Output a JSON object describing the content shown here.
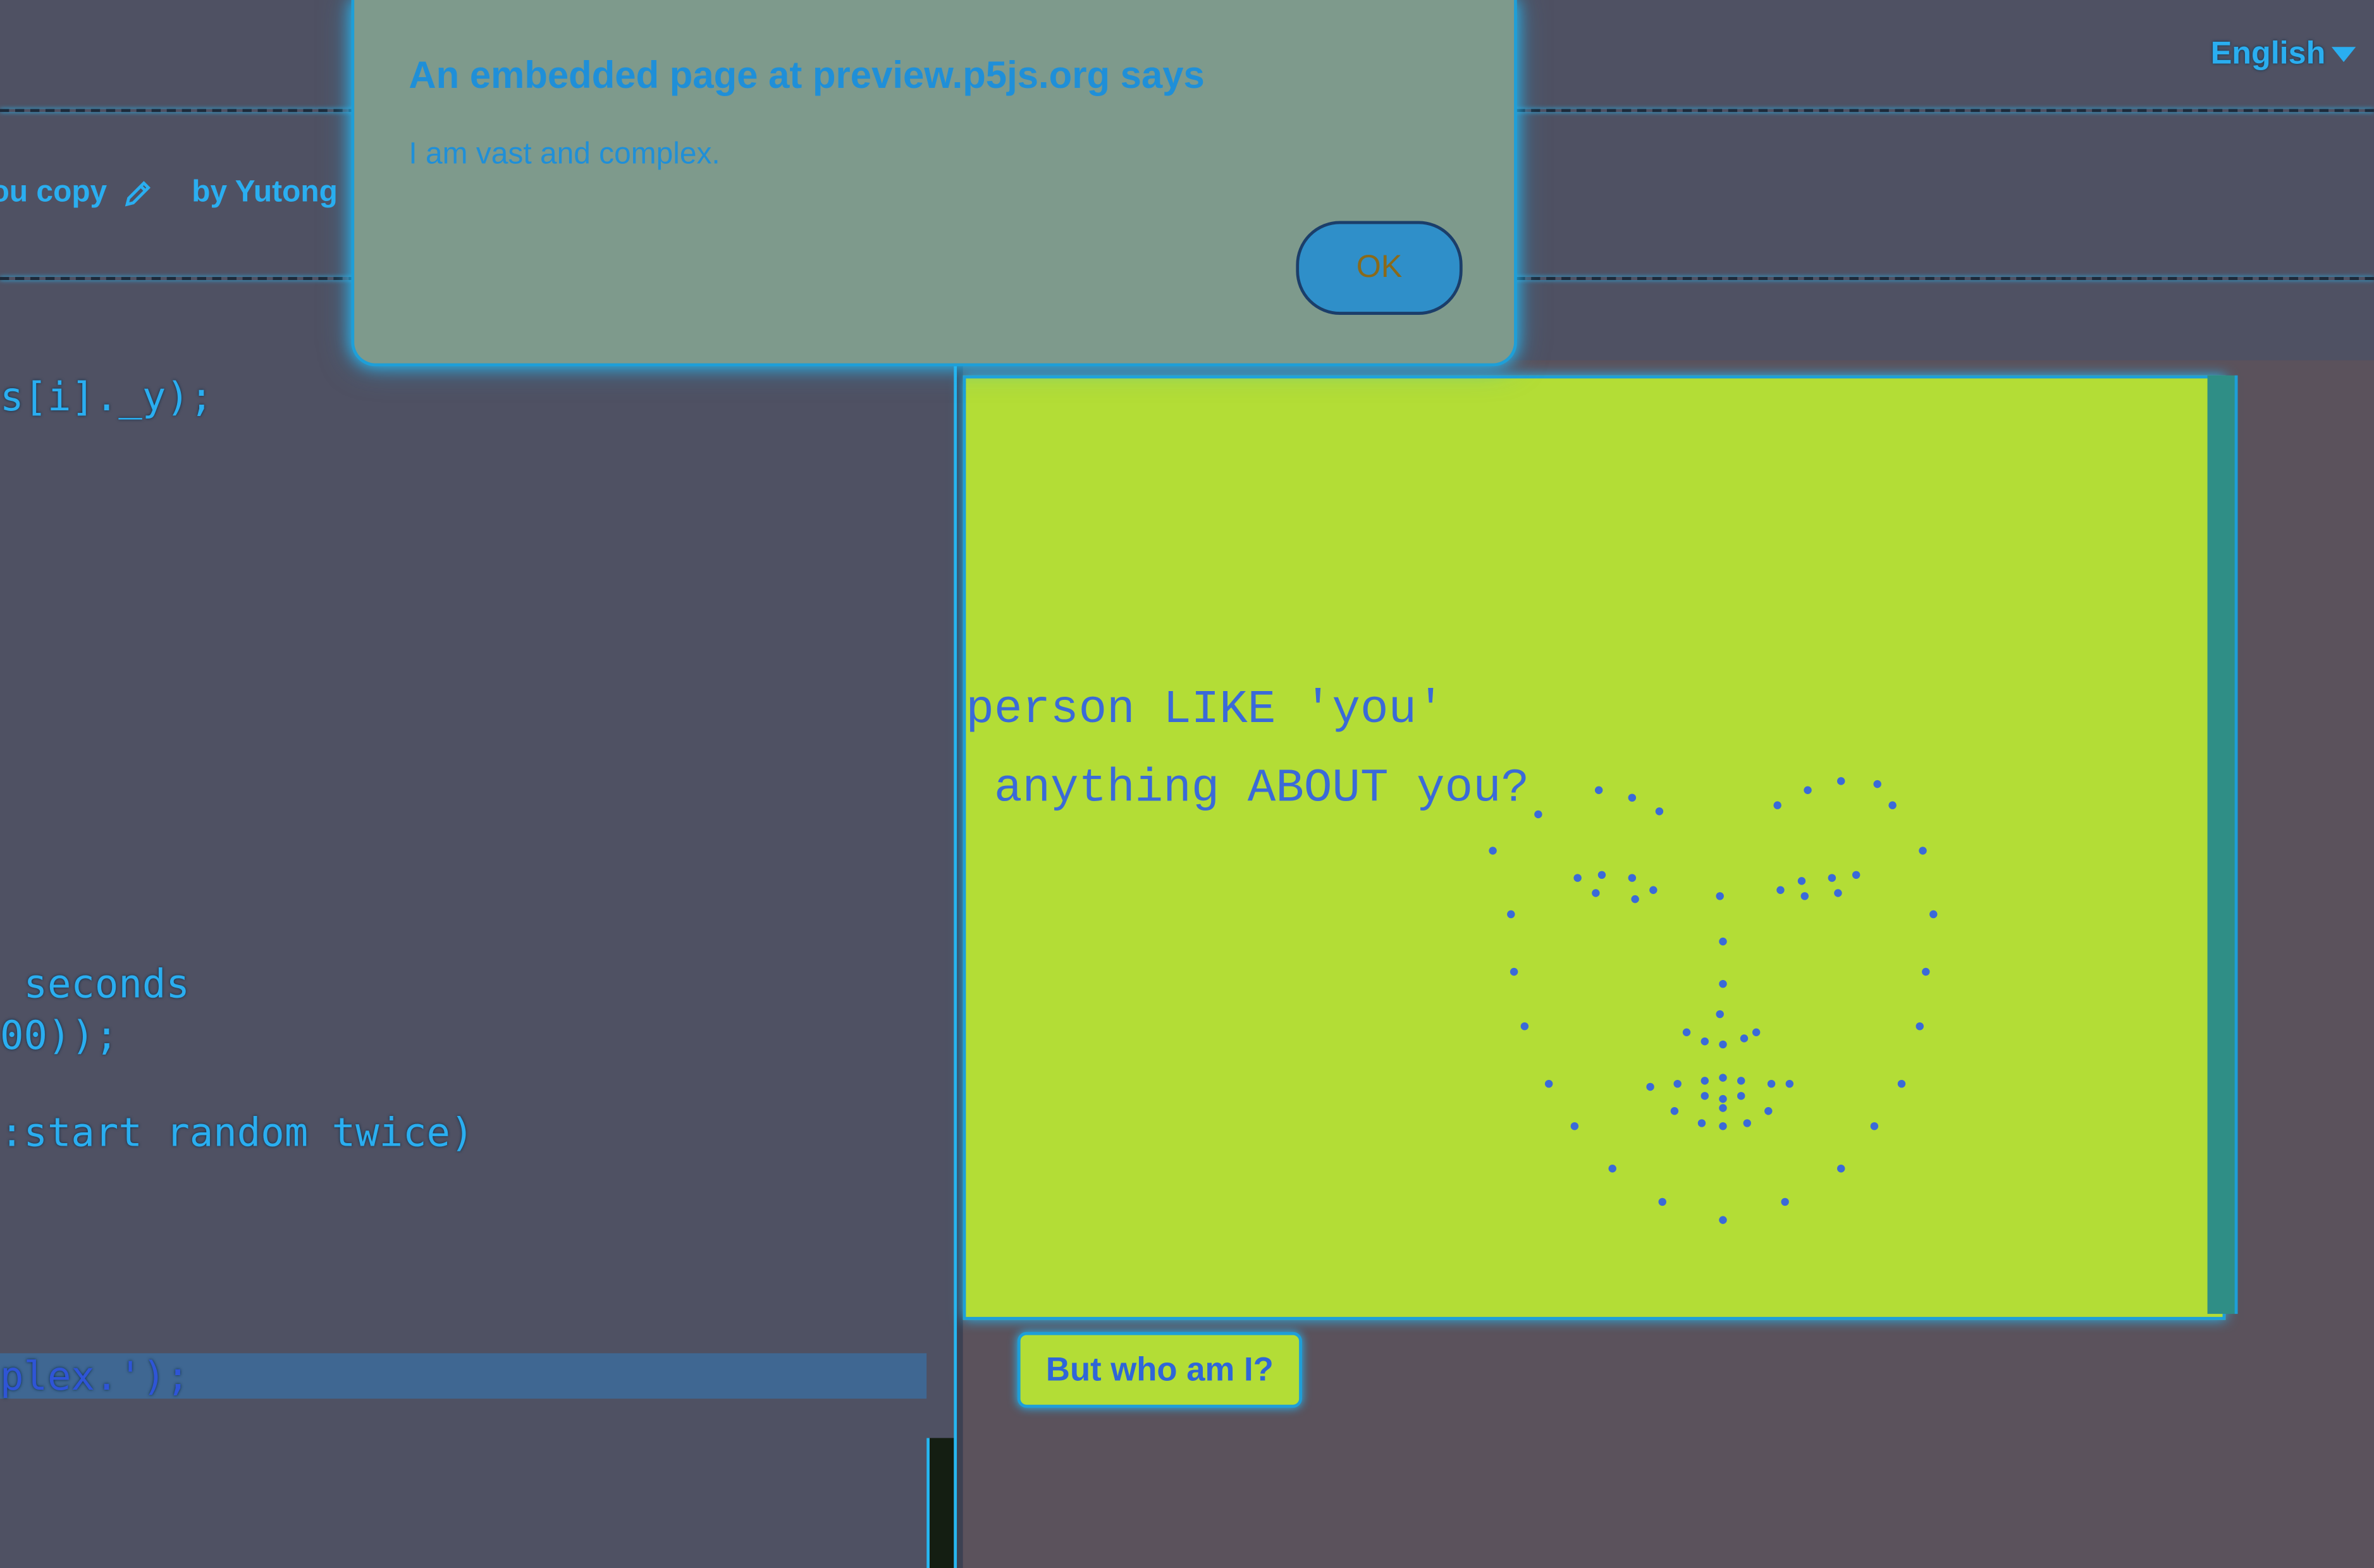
{
  "toolbar": {
    "language": "English",
    "project_name_fragment": "ou copy",
    "author_fragment": "by Yutong"
  },
  "editor": {
    "lines": [
      "s[i]._y);",
      " seconds",
      "00));",
      ":start random twice)",
      "plex.');"
    ]
  },
  "sketch": {
    "text_line_1": "person LIKE 'you'",
    "text_line_2": " anything ABOUT you?",
    "canvas_color": "#b3dd36",
    "dot_color": "#3a6ad8"
  },
  "preview": {
    "button_label": "But who am I?"
  },
  "dialog": {
    "title": "An embedded page at preview.p5js.org says",
    "message": "I am vast and complex.",
    "ok_label": "OK"
  },
  "colors": {
    "accent": "#27b6f0",
    "background": "#4f5163",
    "dialog_bg": "#7e9a8c"
  }
}
